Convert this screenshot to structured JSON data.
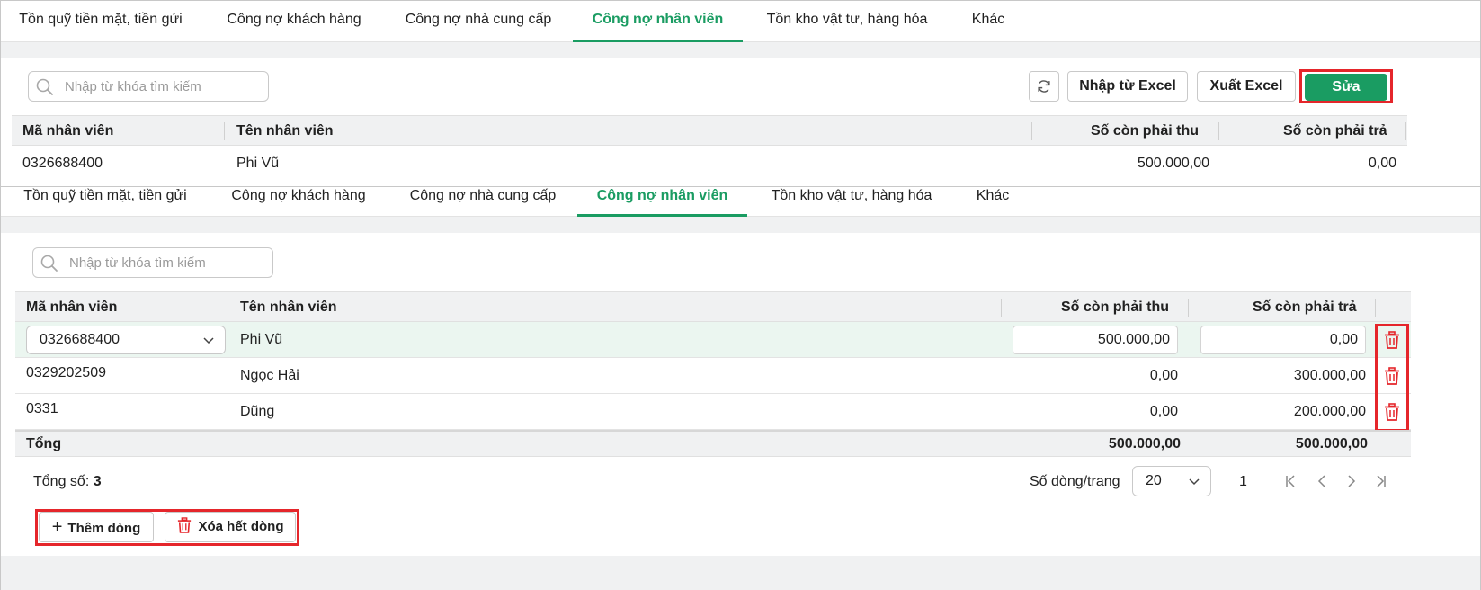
{
  "tabs": [
    {
      "label": "Tồn quỹ tiền mặt, tiền gửi",
      "active": false
    },
    {
      "label": "Công nợ khách hàng",
      "active": false
    },
    {
      "label": "Công nợ nhà cung cấp",
      "active": false
    },
    {
      "label": "Công nợ nhân viên",
      "active": true
    },
    {
      "label": "Tồn kho vật tư, hàng hóa",
      "active": false
    },
    {
      "label": "Khác",
      "active": false
    }
  ],
  "search": {
    "placeholder": "Nhập từ khóa tìm kiếm",
    "icon": "search-icon"
  },
  "toolbar": {
    "refresh_icon": "refresh-icon",
    "import_label": "Nhập từ Excel",
    "export_label": "Xuất Excel",
    "edit_label": "Sửa"
  },
  "columns": {
    "code": "Mã nhân viên",
    "name": "Tên nhân viên",
    "receivable": "Số còn phải thu",
    "payable": "Số còn phải trả"
  },
  "view_rows": [
    {
      "code": "0326688400",
      "name": "Phi Vũ",
      "receivable": "500.000,00",
      "payable": "0,00"
    }
  ],
  "edit_rows": [
    {
      "code": "0326688400",
      "name": "Phi Vũ",
      "receivable": "500.000,00",
      "payable": "0,00"
    },
    {
      "code": "0329202509",
      "name": "Ngọc Hải",
      "receivable": "0,00",
      "payable": "300.000,00"
    },
    {
      "code": "0331",
      "name": "Dũng",
      "receivable": "0,00",
      "payable": "200.000,00"
    }
  ],
  "totals": {
    "label": "Tổng",
    "receivable": "500.000,00",
    "payable": "500.000,00"
  },
  "footer": {
    "count_label": "Tổng số:",
    "count_value": "3",
    "page_size_label": "Số dòng/trang",
    "page_size": "20",
    "page_number": "1"
  },
  "actions": {
    "add_row": "Thêm dòng",
    "delete_all": "Xóa hết dòng"
  },
  "colors": {
    "accent": "#1a9c62",
    "highlight": "#e5262b",
    "row_selected": "#ebf6f0"
  }
}
